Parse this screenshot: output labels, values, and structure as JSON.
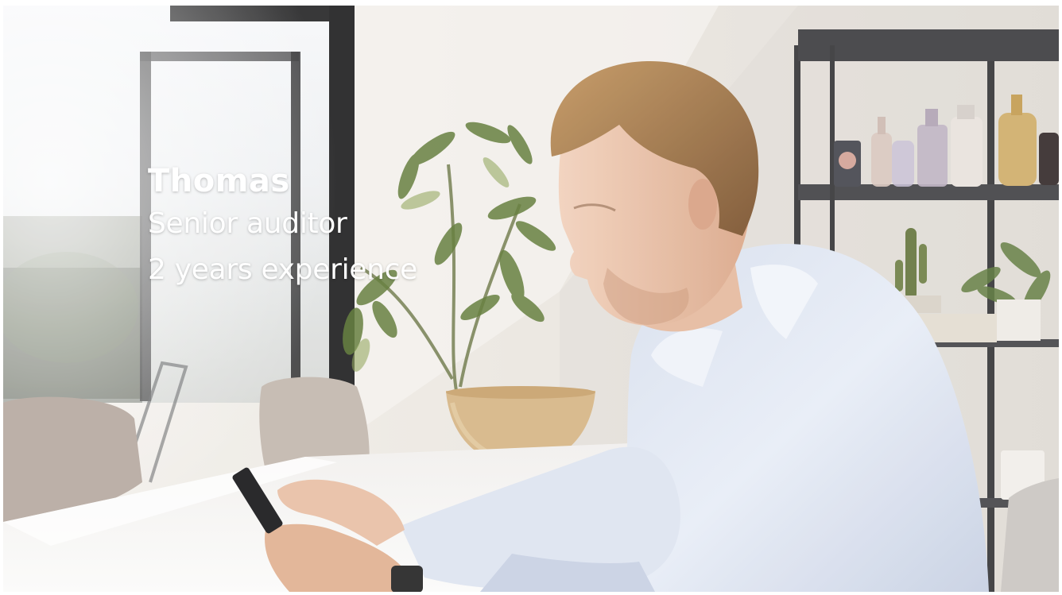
{
  "caption": {
    "name": "Thomas",
    "role": "Senior auditor",
    "experience": "2 years experience"
  },
  "colors": {
    "caption_text": "#ffffff",
    "wall": "#e9e5df",
    "shirt": "#dfe6f4",
    "hair": "#a27544",
    "window_frame": "#2b2b2c",
    "bowl": "#d8b989"
  }
}
